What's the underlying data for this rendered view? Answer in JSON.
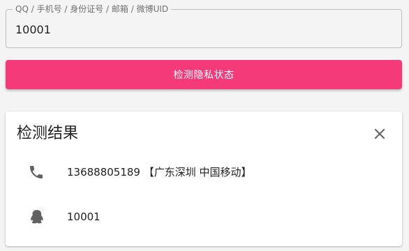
{
  "search": {
    "label": "QQ / 手机号 / 身份证号 / 邮箱 / 微博UID",
    "value": "10001"
  },
  "action": {
    "button_label": "检测隐私状态",
    "accent_color": "#f53a7a"
  },
  "result": {
    "title": "检测结果",
    "close_icon": "close-icon",
    "items": [
      {
        "icon": "phone-icon",
        "text": "13688805189 【广东深圳 中国移动】"
      },
      {
        "icon": "qq-penguin-icon",
        "text": "10001"
      }
    ]
  }
}
